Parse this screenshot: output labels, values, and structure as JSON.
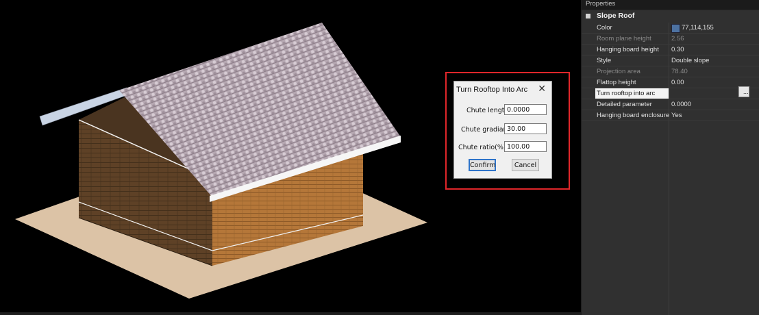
{
  "properties_panel": {
    "header": "Properties",
    "category": "Slope Roof",
    "rows": [
      {
        "key": "Color",
        "value": "77,114,155"
      },
      {
        "key": "Room plane height",
        "value": "2.56"
      },
      {
        "key": "Hanging board height",
        "value": "0.30"
      },
      {
        "key": "Style",
        "value": "Double slope"
      },
      {
        "key": "Projection area",
        "value": "78.40"
      },
      {
        "key": "Flattop height",
        "value": "0.00"
      },
      {
        "key": "Turn rooftop into arc",
        "value": ""
      },
      {
        "key": "Detailed parameter",
        "value": "0.0000"
      },
      {
        "key": "Hanging board enclosure",
        "value": "Yes"
      }
    ],
    "color_swatch": "#4d72a1",
    "ellipsis_label": "..."
  },
  "dialog": {
    "title": "Turn Rooftop Into Arc",
    "close_glyph": "✕",
    "fields": [
      {
        "label": "Chute length:",
        "value": "0.0000"
      },
      {
        "label": "Chute gradiant:",
        "value": "30.00"
      },
      {
        "label": "Chute ratio(%):",
        "value": "100.00"
      }
    ],
    "confirm_label": "Confirm",
    "cancel_label": "Cancel"
  },
  "colors": {
    "highlight": "#e0262a",
    "viewport_bg": "#000000",
    "panel_bg": "#303030"
  }
}
